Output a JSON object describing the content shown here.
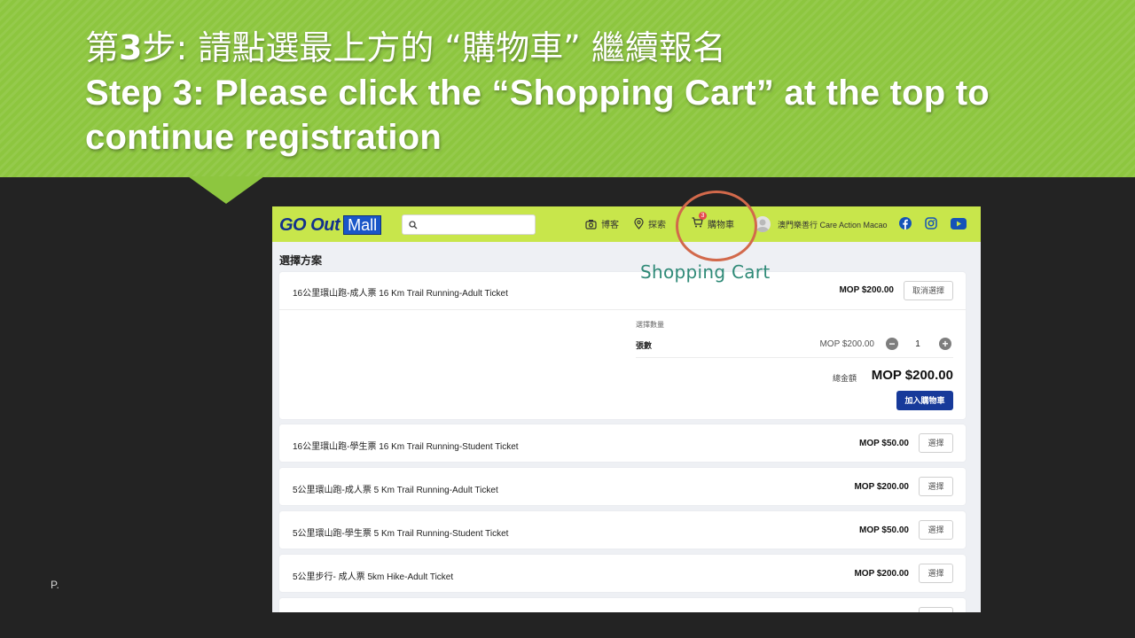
{
  "slide": {
    "title_zh_prefix": "第",
    "title_zh_step": "3",
    "title_zh_rest": "步: 請點選最上方的 “購物車” 繼續報名",
    "title_en_line1": "Step 3: Please click the “Shopping Cart” at the top to",
    "title_en_line2": "continue registration",
    "page_number": "P.",
    "annotation": "Shopping Cart",
    "colors": {
      "banner": "#8dc63f",
      "background": "#232323",
      "highlight": "#d2694b",
      "annotation": "#2f8a77"
    }
  },
  "app": {
    "logo_go": "GO Out",
    "logo_mall": "Mall",
    "search": {
      "placeholder": "",
      "value": ""
    },
    "nav": {
      "blog": "博客",
      "explore": "探索",
      "cart": "購物車",
      "cart_count": "3"
    },
    "user_name": "澳門樂善行 Care Action Macao",
    "social_icons": [
      "facebook-icon",
      "instagram-icon",
      "youtube-icon"
    ],
    "section_title": "選擇方案",
    "selected_ticket": {
      "name": "16公里環山跑-成人票 16 Km Trail Running-Adult Ticket",
      "price": "MOP $200.00",
      "cancel_label": "取消選擇",
      "qty_heading": "選擇數量",
      "qty_label": "張數",
      "unit_price": "MOP $200.00",
      "quantity": "1",
      "total_label": "總金額",
      "total_value": "MOP $200.00",
      "add_to_cart_label": "加入購物車"
    },
    "tickets": [
      {
        "name": "16公里環山跑-學生票 16 Km Trail Running-Student Ticket",
        "price": "MOP $50.00",
        "select_label": "選擇"
      },
      {
        "name": "5公里環山跑-成人票 5 Km Trail Running-Adult Ticket",
        "price": "MOP $200.00",
        "select_label": "選擇"
      },
      {
        "name": "5公里環山跑-學生票 5 Km Trail Running-Student Ticket",
        "price": "MOP $50.00",
        "select_label": "選擇"
      },
      {
        "name": "5公里步行- 成人票 5km Hike-Adult Ticket",
        "price": "MOP $200.00",
        "select_label": "選擇"
      }
    ],
    "colors": {
      "topbar": "#c8e64b",
      "primary": "#173a9a",
      "logo": "#13318c"
    }
  }
}
